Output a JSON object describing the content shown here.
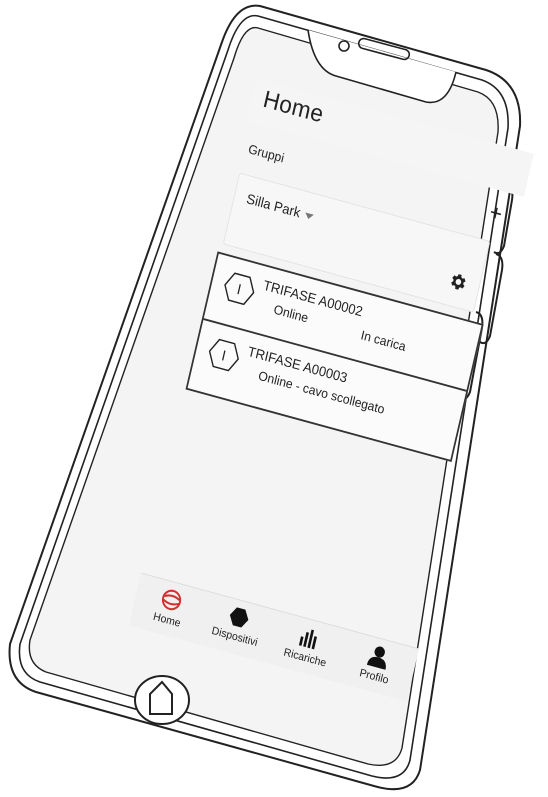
{
  "header": {
    "title": "Home"
  },
  "groups": {
    "label": "Gruppi",
    "add_label": "+",
    "selected": "Silla Park"
  },
  "devices": [
    {
      "name": "TRIFASE A00002",
      "status": "Online",
      "state": "In carica",
      "icon_text": "I"
    },
    {
      "name": "TRIFASE A00003",
      "status": "Online - cavo scollegato",
      "state": "",
      "icon_text": "I"
    }
  ],
  "nav": [
    {
      "label": "Home",
      "icon": "home-logo-icon"
    },
    {
      "label": "Dispositivi",
      "icon": "hexagon-icon"
    },
    {
      "label": "Ricariche",
      "icon": "bar-chart-icon"
    },
    {
      "label": "Profilo",
      "icon": "person-icon"
    }
  ],
  "colors": {
    "accent": "#d32f2f",
    "text": "#222222",
    "nav_bg": "#f0f0f0"
  }
}
